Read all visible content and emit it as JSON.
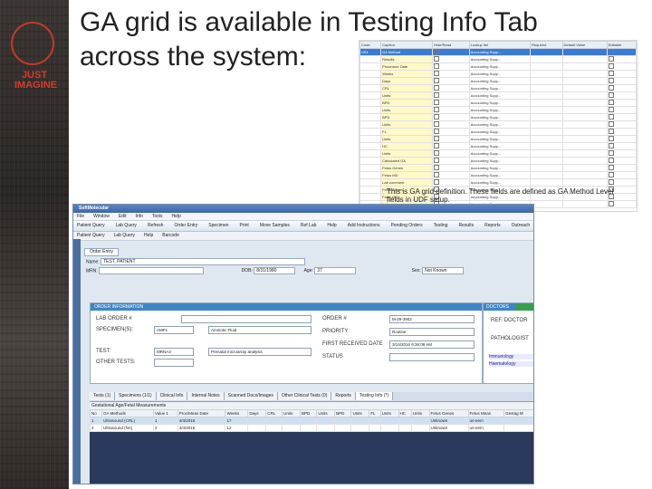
{
  "slide": {
    "title_line1": "GA grid is available in Testing Info Tab",
    "title_line2": "across the system:",
    "logo_text": "JUST IMAGINE"
  },
  "ga_definition": {
    "headers": [
      "Code",
      "Caption",
      "Hide/Read",
      "Lookup list",
      "Required",
      "Default Value",
      "Editable"
    ],
    "rows": [
      {
        "code": "US1",
        "caption": "GA Method",
        "sel": true
      },
      {
        "code": "",
        "caption": "Results",
        "sel": false
      },
      {
        "code": "",
        "caption": "Procedure Date",
        "sel": false
      },
      {
        "code": "",
        "caption": "Weeks",
        "sel": false
      },
      {
        "code": "",
        "caption": "Days",
        "sel": false
      },
      {
        "code": "",
        "caption": "CRL",
        "sel": false
      },
      {
        "code": "",
        "caption": "Units",
        "sel": false
      },
      {
        "code": "",
        "caption": "BPD",
        "sel": false
      },
      {
        "code": "",
        "caption": "Units",
        "sel": false
      },
      {
        "code": "",
        "caption": "BPD",
        "sel": false
      },
      {
        "code": "",
        "caption": "Units",
        "sel": false
      },
      {
        "code": "",
        "caption": "FL",
        "sel": false
      },
      {
        "code": "",
        "caption": "Units",
        "sel": false
      },
      {
        "code": "",
        "caption": "HC",
        "sel": false
      },
      {
        "code": "",
        "caption": "Units",
        "sel": false
      },
      {
        "code": "",
        "caption": "Calculated GA",
        "sel": false
      },
      {
        "code": "",
        "caption": "Fetus Genes",
        "sel": false
      },
      {
        "code": "",
        "caption": "Fetus MD",
        "sel": false
      },
      {
        "code": "",
        "caption": "Lab comment",
        "sel": false
      },
      {
        "code": "",
        "caption": "Fetus Genes",
        "sel": false
      },
      {
        "code": "",
        "caption": "Fetus MD",
        "sel": false
      },
      {
        "code": "",
        "caption": "Lab comment",
        "sel": false
      }
    ],
    "lookup_value": "Accounting Supp...",
    "caption_line1": "This is GA grid definition. These fields are defined as GA Method Level",
    "caption_line2": "fields in UDF setup."
  },
  "app": {
    "title": "SoftMolecular",
    "menu": [
      "File",
      "Window",
      "Edit",
      "Info",
      "Tools",
      "Help"
    ],
    "toolbar": [
      "Patient Query",
      "Lab Query",
      "Refresh",
      "Order Entry",
      "Specimen",
      "Print",
      "Move Samples",
      "Ref Lab",
      "Help",
      "Add Instructions",
      "Pending Orders",
      "Testing",
      "Results",
      "Reports",
      "Outreach"
    ],
    "tb2": [
      "Patient Query",
      "Lab Query",
      "Help",
      "Barcode"
    ],
    "order_entry_tab": "Order Entry",
    "name_label": "Name:",
    "name_value": "TEST, PATIENT",
    "mrn_label": "MRN:",
    "dob_label": "DOB:",
    "dob_value": "8/31/1980",
    "age_label": "Age:",
    "age_value": "37",
    "sex_label": "Sex:",
    "sex_value": "Not Known",
    "order_info_header": "ORDER INFORMATION",
    "doctors_header": "DOCTORS",
    "lab_order_label": "LAB ORDER #",
    "specimens_label": "SPECIMEN(S):",
    "specimen_value": "AMF1",
    "specimen_desc": "Amniotic Fluid",
    "test_label": "TEST:",
    "test_value": "MRNA3",
    "test_desc": "Prenatal microarray analysis",
    "other_tests_label": "OTHER TESTS:",
    "order_hash_label": "ORDER #",
    "order_value": "M-29-3902",
    "priority_label": "PRIORITY",
    "priority_value": "Routine",
    "first_received_label": "FIRST RECEIVED DATE",
    "first_received_value": "3/14/2016 9:36:09 AM",
    "status_label": "STATUS",
    "ref_doctor": "REF. DOCTOR",
    "pathologist": "PATHOLOGIST",
    "dept1": "Immunology",
    "dept2": "Haematology",
    "bottom_tabs": [
      "Tests (1)",
      "Specimens (1/1)",
      "Clinical Info",
      "Internal Notes",
      "Scanned Docs/Images",
      "Other Clinical Tests (0)",
      "Reports",
      "Testing Info (*)"
    ],
    "grid_caption": "Gestational Age/Fetal Measurements",
    "grid_headers": [
      "No",
      "GA Methods",
      "Value 1",
      "Proc/Meas Date",
      "Weeks",
      "Days",
      "CRL",
      "Units",
      "BPD",
      "Units",
      "BPD",
      "Units",
      "FL",
      "Units",
      "HC",
      "Units",
      "Fetus Genes",
      "Fetus Meas",
      "Gestag M"
    ],
    "grid_rows": [
      [
        "1",
        "Ultrasound (CRL)",
        "1",
        "4/4/2016",
        "17",
        "",
        "",
        "",
        "",
        "",
        "",
        "",
        "",
        "",
        "",
        "",
        "Unknown",
        "un-eem",
        ""
      ],
      [
        "2",
        "Ultrasound (NA)",
        "2",
        "4/4/2016",
        "12",
        "",
        "",
        "",
        "",
        "",
        "",
        "",
        "",
        "",
        "",
        "",
        "Unknown",
        "un-eem",
        ""
      ]
    ]
  }
}
